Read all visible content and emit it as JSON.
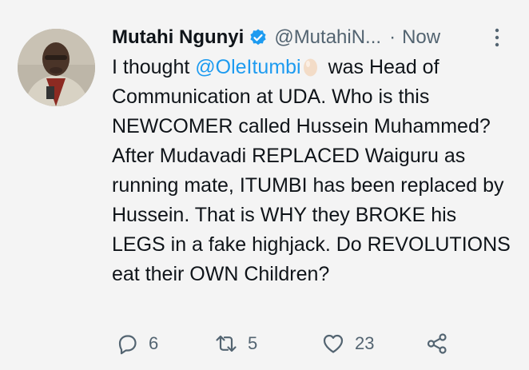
{
  "tweet": {
    "author_name": "Mutahi Ngunyi",
    "handle": "@MutahiN...",
    "separator": "·",
    "time": "Now",
    "body": {
      "before_mention": "I thought ",
      "mention": "@OleItumbi",
      "after_mention": " was Head of Communication at UDA. Who is this NEWCOMER called Hussein Muhammed? After Mudavadi REPLACED Waiguru as running mate, ITUMBI has been replaced by Hussein. That is WHY they BROKE his LEGS in a fake highjack. Do REVOLUTIONS eat their OWN Children?"
    },
    "actions": {
      "replies": "6",
      "retweets": "5",
      "likes": "23"
    }
  },
  "colors": {
    "accent": "#1d9bf0",
    "muted": "#536471",
    "text": "#0f1419",
    "background": "#f4f4f4"
  },
  "icons": [
    "verified-badge-icon",
    "more-options-icon",
    "egg-emoji-icon",
    "reply-icon",
    "retweet-icon",
    "like-icon",
    "share-icon"
  ]
}
